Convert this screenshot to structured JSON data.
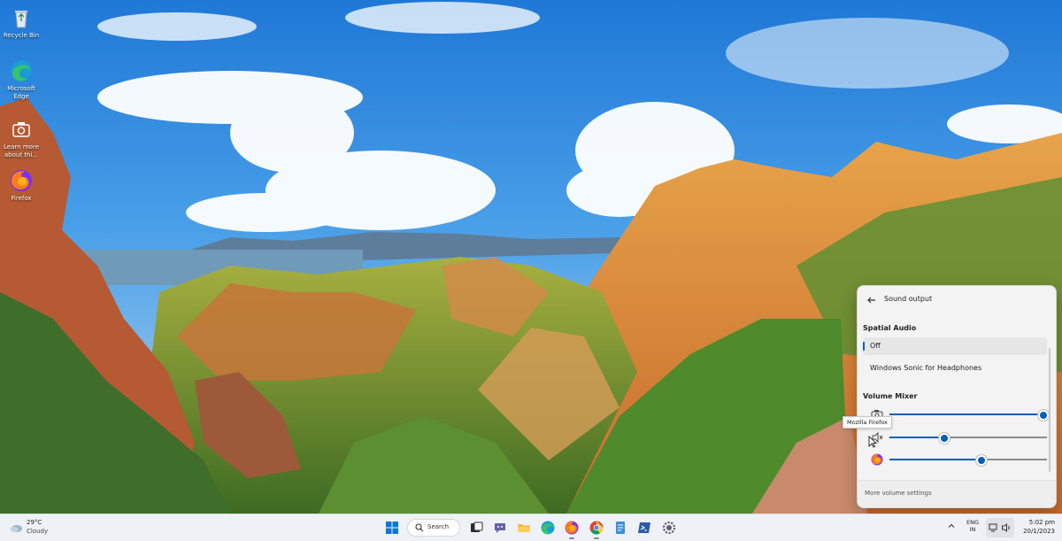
{
  "desktop": {
    "icons": [
      {
        "label": "Recycle Bin",
        "icon": "recycle-bin-icon"
      },
      {
        "label": "Microsoft Edge",
        "icon": "edge-icon"
      },
      {
        "label": "Learn more about thi...",
        "icon": "camera-icon"
      },
      {
        "label": "Firefox",
        "icon": "firefox-icon"
      }
    ]
  },
  "sound_flyout": {
    "title": "Sound output",
    "spatial_audio": {
      "heading": "Spatial Audio",
      "options": [
        {
          "label": "Off",
          "selected": true
        },
        {
          "label": "Windows Sonic for Headphones",
          "selected": false
        }
      ]
    },
    "volume_mixer": {
      "heading": "Volume Mixer",
      "rows": [
        {
          "app": "camera-icon",
          "level": 1.0
        },
        {
          "app": "speaker-icon",
          "level": 0.35
        },
        {
          "app": "firefox-icon",
          "level": 0.58
        }
      ]
    },
    "tooltip": "Mozilla Firefox",
    "more_link": "More volume settings"
  },
  "taskbar": {
    "weather": {
      "temp": "29°C",
      "condition": "Cloudy"
    },
    "search_label": "Search",
    "apps": [
      "windows-start-icon",
      "search-icon",
      "task-view-icon",
      "teams-chat-icon",
      "file-explorer-icon",
      "edge-icon",
      "firefox-icon",
      "chrome-icon",
      "notepad-icon",
      "powershell-icon",
      "settings-icon"
    ],
    "language": {
      "line1": "ENG",
      "line2": "IN"
    },
    "time": "5:02 pm",
    "date": "20/1/2023"
  },
  "colors": {
    "accent": "#005fb8",
    "taskbar_bg": "#eef1f5",
    "flyout_bg": "#f3f3f3"
  }
}
